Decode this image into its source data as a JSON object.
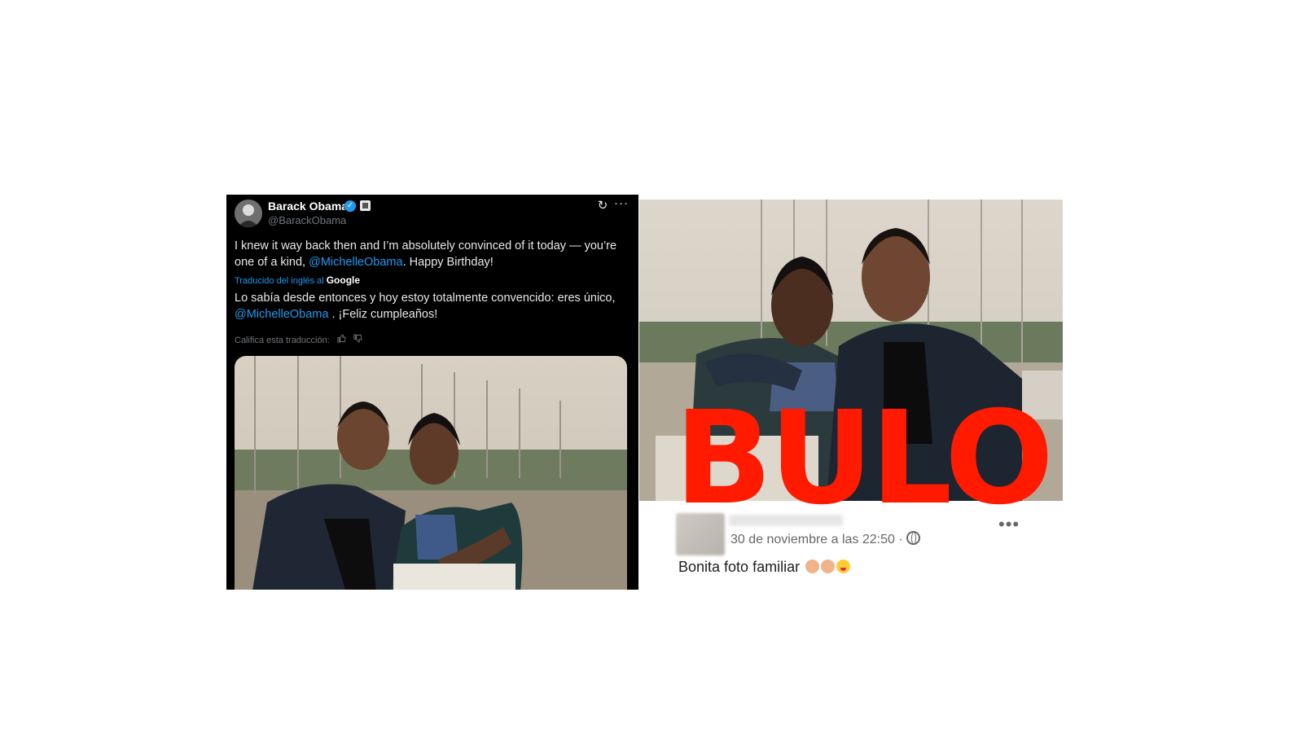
{
  "tweet": {
    "author_name": "Barack Obama",
    "verified_mark": "✓",
    "handle": "@BarackObama",
    "refresh_icon": "↻",
    "more_icon": "···",
    "text_part1": "I knew it way back then and I’m absolutely convinced of it today — you’re one of a kind, ",
    "mention": "@MichelleObama",
    "text_part2": ". Happy Birthday!",
    "translated_label": "Traducido del inglés al ",
    "translated_provider": "Google",
    "translation_part1": "Lo sabía desde entonces y hoy estoy totalmente convencido: eres único, ",
    "translation_mention": "@MichelleObama",
    "translation_part2": " . ¡Feliz cumpleaños!",
    "rate_label": "Califica esta traducción:",
    "thumb_up_icon": "👍",
    "thumb_down_icon": "👎",
    "photo": {
      "icon": "photo-image",
      "description_colors": [
        "#c9c2b4",
        "#2b3240",
        "#8fa1b8"
      ]
    }
  },
  "facebook": {
    "overlay_label": "BULO",
    "overlay_color": "#ff1a00",
    "timestamp": "30 de noviembre a las 22:50 ·",
    "more_icon": "•••",
    "post_text": "Bonita foto familiar",
    "emojis": [
      "clapping-hands",
      "clapping-hands",
      "winking-face-tongue"
    ]
  }
}
